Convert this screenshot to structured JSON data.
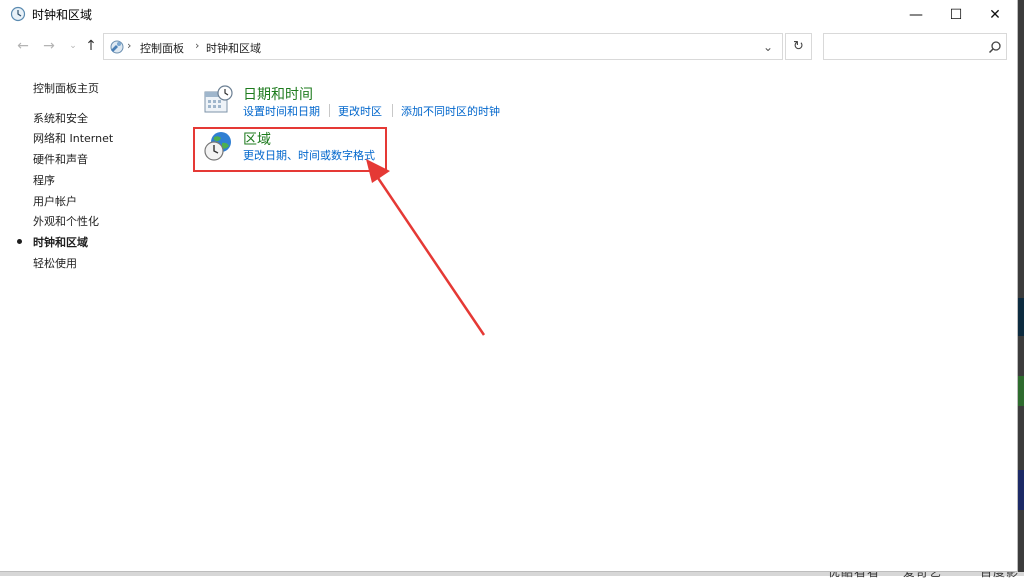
{
  "window": {
    "title": "时钟和区域",
    "min_symbol": "—",
    "max_symbol": "☐",
    "close_symbol": "✕"
  },
  "nav": {
    "back_symbol": "←",
    "forward_symbol": "→",
    "recent_symbol": "⌄",
    "up_symbol": "↑"
  },
  "address": {
    "separator": "›",
    "crumbs": [
      "控制面板",
      "时钟和区域"
    ],
    "dropdown_symbol": "⌄",
    "refresh_symbol": "↻"
  },
  "search": {
    "value": "",
    "placeholder": ""
  },
  "sidebar": {
    "home": "控制面板主页",
    "items": [
      {
        "label": "系统和安全",
        "active": false
      },
      {
        "label": "网络和 Internet",
        "active": false
      },
      {
        "label": "硬件和声音",
        "active": false
      },
      {
        "label": "程序",
        "active": false
      },
      {
        "label": "用户帐户",
        "active": false
      },
      {
        "label": "外观和个性化",
        "active": false
      },
      {
        "label": "时钟和区域",
        "active": true
      },
      {
        "label": "轻松使用",
        "active": false
      }
    ]
  },
  "categories": [
    {
      "title": "日期和时间",
      "icon": "calendar-clock-icon",
      "links": [
        "设置时间和日期",
        "更改时区",
        "添加不同时区的时钟"
      ]
    },
    {
      "title": "区域",
      "icon": "globe-clock-icon",
      "links": [
        "更改日期、时间或数字格式"
      ]
    }
  ],
  "annotation": {
    "color": "#e53935"
  },
  "background_taskbar_text": [
    "优酷看看",
    "爱奇艺",
    "百度影"
  ],
  "colors": {
    "category_title": "#1e7b1e",
    "link": "#0066cc"
  }
}
